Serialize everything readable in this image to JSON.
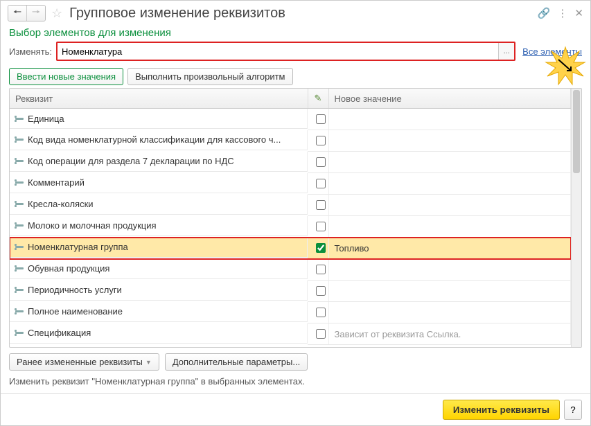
{
  "title": "Групповое изменение реквизитов",
  "section_title": "Выбор элементов для изменения",
  "change_label": "Изменять:",
  "change_value": "Номенклатура",
  "change_btn": "...",
  "all_elements": "Все элементы",
  "tabs": {
    "enter": "Ввести новые значения",
    "alg": "Выполнить произвольный алгоритм"
  },
  "columns": {
    "req": "Реквизит",
    "newval": "Новое значение"
  },
  "rows": [
    {
      "label": "Единица",
      "checked": false,
      "value": "",
      "hl": false
    },
    {
      "label": "Код вида номенклатурной классификации для кассового ч...",
      "checked": false,
      "value": "",
      "hl": false
    },
    {
      "label": "Код операции для раздела 7 декларации по НДС",
      "checked": false,
      "value": "",
      "hl": false
    },
    {
      "label": "Комментарий",
      "checked": false,
      "value": "",
      "hl": false
    },
    {
      "label": "Кресла-коляски",
      "checked": false,
      "value": "",
      "hl": false
    },
    {
      "label": "Молоко и молочная продукция",
      "checked": false,
      "value": "",
      "hl": false
    },
    {
      "label": "Номенклатурная группа",
      "checked": true,
      "value": "Топливо",
      "hl": true
    },
    {
      "label": "Обувная продукция",
      "checked": false,
      "value": "",
      "hl": false
    },
    {
      "label": "Периодичность услуги",
      "checked": false,
      "value": "",
      "hl": false
    },
    {
      "label": "Полное наименование",
      "checked": false,
      "value": "",
      "hl": false
    },
    {
      "label": "Спецификация",
      "checked": false,
      "value": "Зависит от реквизита Ссылка.",
      "placeholder": true,
      "hl": false
    }
  ],
  "bottom": {
    "prev": "Ранее измененные реквизиты",
    "extra": "Дополнительные параметры..."
  },
  "status": "Изменить реквизит \"Номенклатурная группа\" в выбранных элементах.",
  "footer": {
    "apply": "Изменить реквизиты",
    "help": "?"
  }
}
